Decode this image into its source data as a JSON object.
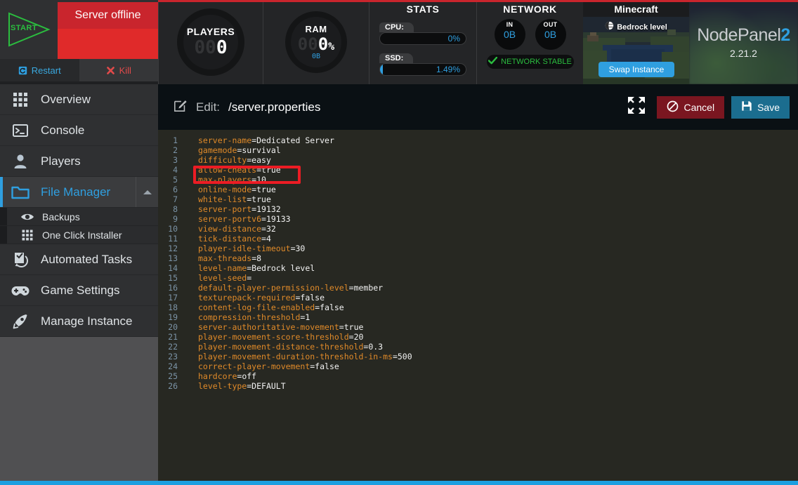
{
  "header": {
    "start_button": {
      "label": "START",
      "icon": "play-triangle-icon"
    },
    "status": {
      "text": "Server offline",
      "color": "#c9252d"
    },
    "controls": [
      {
        "label": "Restart",
        "icon": "restart-icon",
        "color": "#3aa9e0"
      },
      {
        "label": "Kill",
        "icon": "x-icon",
        "color": "#e04a4a"
      }
    ],
    "gauges": [
      {
        "title": "PLAYERS",
        "placeholder": "00",
        "value": "0",
        "suffix": "",
        "sub": ""
      },
      {
        "title": "RAM",
        "placeholder": "00",
        "value": "0",
        "suffix": "%",
        "sub": "0B"
      }
    ],
    "stats": {
      "title": "STATS",
      "bars": [
        {
          "label": "CPU:",
          "value": "0%",
          "percent": 0
        },
        {
          "label": "SSD:",
          "value": "1.49%",
          "percent": 1.49
        }
      ]
    },
    "network": {
      "title": "NETWORK",
      "circles": [
        {
          "label": "IN",
          "value": "0B"
        },
        {
          "label": "OUT",
          "value": "0B"
        }
      ],
      "status": {
        "text": "NETWORK STABLE",
        "icon": "check-icon",
        "color": "#2bbd3f"
      }
    },
    "minecraft": {
      "title": "Minecraft",
      "level_label": "Bedrock level",
      "level_icon": "globe-icon",
      "swap_button": "Swap Instance"
    },
    "brand": {
      "name_light": "NodePanel",
      "name_accent": "2",
      "version": "2.21.2",
      "accent": "#2f9fe0"
    }
  },
  "sidebar": {
    "items": [
      {
        "label": "Overview",
        "icon": "grid-icon",
        "active": false
      },
      {
        "label": "Console",
        "icon": "terminal-icon",
        "active": false
      },
      {
        "label": "Players",
        "icon": "user-icon",
        "active": false
      },
      {
        "label": "File Manager",
        "icon": "folder-icon",
        "active": true,
        "caret": "chevron-up-icon"
      },
      {
        "label": "Automated Tasks",
        "icon": "tasks-icon",
        "active": false
      },
      {
        "label": "Game Settings",
        "icon": "gamepad-icon",
        "active": false
      },
      {
        "label": "Manage Instance",
        "icon": "rocket-icon",
        "active": false
      }
    ],
    "subitems": [
      {
        "label": "Backups",
        "icon": "eye-icon"
      },
      {
        "label": "One Click Installer",
        "icon": "grid-icon"
      }
    ]
  },
  "editor": {
    "edit_label": "Edit:",
    "file_path": "/server.properties",
    "edit_icon": "pencil-square-icon",
    "fullscreen_icon": "expand-arrows-icon",
    "cancel_button": {
      "label": "Cancel",
      "icon": "no-entry-icon",
      "color": "#7a1620"
    },
    "save_button": {
      "label": "Save",
      "icon": "floppy-disk-icon",
      "color": "#1b6d8f"
    },
    "highlight": {
      "line": 4,
      "color": "#ec1c24"
    },
    "lines": [
      {
        "n": 1,
        "key": "server-name",
        "value": "=Dedicated Server"
      },
      {
        "n": 2,
        "key": "gamemode",
        "value": "=survival"
      },
      {
        "n": 3,
        "key": "difficulty",
        "value": "=easy"
      },
      {
        "n": 4,
        "key": "allow-cheats",
        "value": "=true"
      },
      {
        "n": 5,
        "key": "max-players",
        "value": "=10"
      },
      {
        "n": 6,
        "key": "online-mode",
        "value": "=true"
      },
      {
        "n": 7,
        "key": "white-list",
        "value": "=true"
      },
      {
        "n": 8,
        "key": "server-port",
        "value": "=19132"
      },
      {
        "n": 9,
        "key": "server-portv6",
        "value": "=19133"
      },
      {
        "n": 10,
        "key": "view-distance",
        "value": "=32"
      },
      {
        "n": 11,
        "key": "tick-distance",
        "value": "=4"
      },
      {
        "n": 12,
        "key": "player-idle-timeout",
        "value": "=30"
      },
      {
        "n": 13,
        "key": "max-threads",
        "value": "=8"
      },
      {
        "n": 14,
        "key": "level-name",
        "value": "=Bedrock level"
      },
      {
        "n": 15,
        "key": "level-seed",
        "value": "="
      },
      {
        "n": 16,
        "key": "default-player-permission-level",
        "value": "=member"
      },
      {
        "n": 17,
        "key": "texturepack-required",
        "value": "=false"
      },
      {
        "n": 18,
        "key": "content-log-file-enabled",
        "value": "=false"
      },
      {
        "n": 19,
        "key": "compression-threshold",
        "value": "=1"
      },
      {
        "n": 20,
        "key": "server-authoritative-movement",
        "value": "=true"
      },
      {
        "n": 21,
        "key": "player-movement-score-threshold",
        "value": "=20"
      },
      {
        "n": 22,
        "key": "player-movement-distance-threshold",
        "value": "=0.3"
      },
      {
        "n": 23,
        "key": "player-movement-duration-threshold-in-ms",
        "value": "=500"
      },
      {
        "n": 24,
        "key": "correct-player-movement",
        "value": "=false"
      },
      {
        "n": 25,
        "key": "hardcore",
        "value": "=off"
      },
      {
        "n": 26,
        "key": "level-type",
        "value": "=DEFAULT"
      }
    ]
  }
}
